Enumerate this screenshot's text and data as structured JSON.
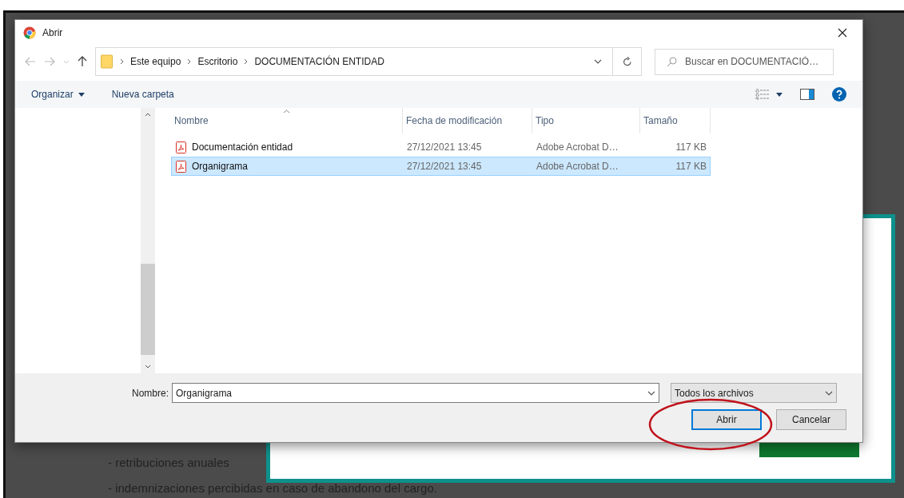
{
  "background": {
    "lines": [
      "- retribuciones anuales",
      "- indemnizaciones percibidas en caso de abandono del cargo."
    ]
  },
  "dialog": {
    "title": "Abrir",
    "breadcrumb": [
      "Este equipo",
      "Escritorio",
      "DOCUMENTACIÓN ENTIDAD"
    ],
    "search": {
      "placeholder": "Buscar en DOCUMENTACIÓ…"
    },
    "toolbar": [
      "Organizar",
      "Nueva carpeta"
    ],
    "columns": [
      "Nombre",
      "Fecha de modificación",
      "Tipo",
      "Tamaño"
    ],
    "files": [
      {
        "name": "Documentación entidad",
        "date": "27/12/2021 13:45",
        "type": "Adobe Acrobat D…",
        "size": "117 KB",
        "selected": false
      },
      {
        "name": "Organigrama",
        "date": "27/12/2021 13:45",
        "type": "Adobe Acrobat D…",
        "size": "117 KB",
        "selected": true
      }
    ],
    "filename": {
      "label": "Nombre:",
      "value": "Organigrama"
    },
    "filetype": "Todos los archivos",
    "buttons": [
      {
        "label": "Abrir",
        "kind": "default"
      },
      {
        "label": "Cancelar",
        "kind": "normal"
      }
    ]
  }
}
